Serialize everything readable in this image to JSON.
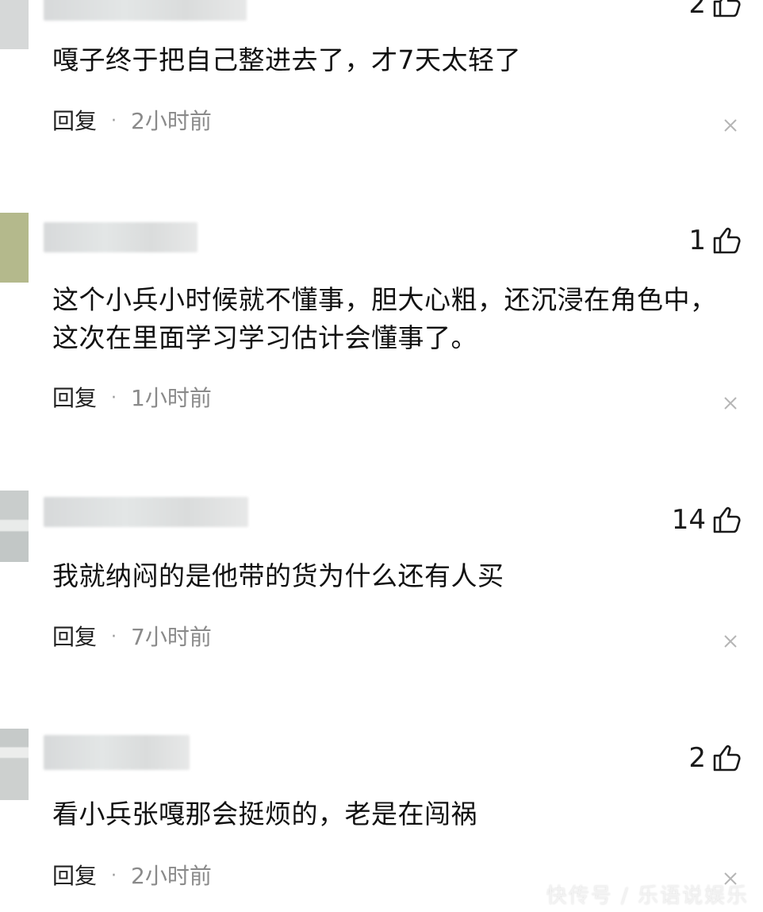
{
  "comments": [
    {
      "likes": "2",
      "text": "嘎子终于把自己整进去了，才7天太轻了",
      "reply_label": "回复",
      "separator": "·",
      "time": "2小时前"
    },
    {
      "likes": "1",
      "text": "这个小兵小时候就不懂事，胆大心粗，还沉浸在角色中，\n这次在里面学习学习估计会懂事了。",
      "reply_label": "回复",
      "separator": "·",
      "time": "1小时前"
    },
    {
      "likes": "14",
      "text": "我就纳闷的是他带的货为什么还有人买",
      "reply_label": "回复",
      "separator": "·",
      "time": "7小时前"
    },
    {
      "likes": "2",
      "text": "看小兵张嘎那会挺烦的，老是在闯祸",
      "reply_label": "回复",
      "separator": "·",
      "time": "2小时前"
    }
  ],
  "icons": {
    "like": "thumbs-up-icon",
    "dismiss": "close-icon"
  },
  "watermark": "快传号 / 乐语说娱乐"
}
